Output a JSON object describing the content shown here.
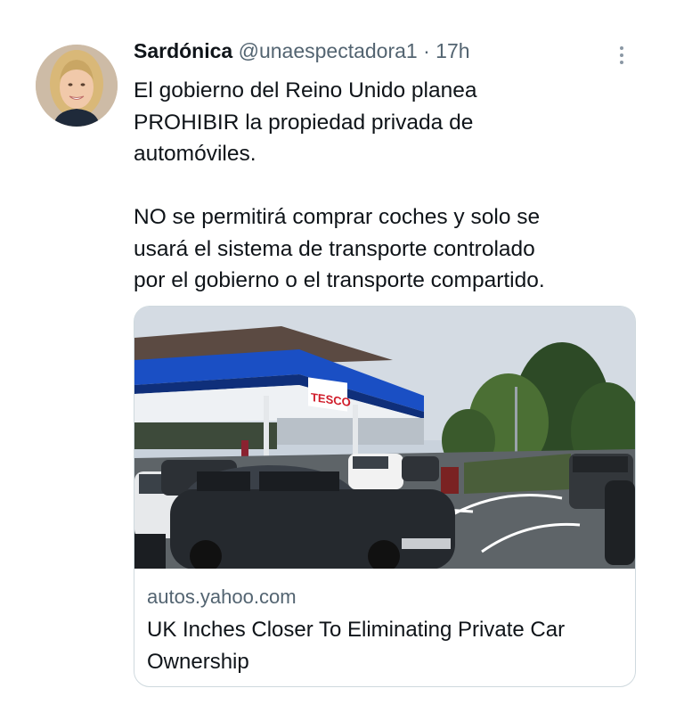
{
  "tweet": {
    "author_name": "Sardónica",
    "handle": "@unaespectadora1",
    "separator": "·",
    "time": "17h",
    "text_lines_1": [
      "El gobierno del Reino Unido planea",
      "PROHIBIR la propiedad privada de",
      "automóviles."
    ],
    "text_lines_2": [
      "NO se permitirá comprar coches  y solo se",
      "usará el sistema de transporte controlado",
      "por el gobierno o el transporte compartido."
    ]
  },
  "card": {
    "domain": "autos.yahoo.com",
    "title": "UK Inches Closer To Eliminating Private Car Ownership",
    "image_sign": "TESCO"
  },
  "icons": {
    "more": "more-vertical-icon",
    "avatar": "avatar"
  },
  "colors": {
    "text_primary": "#0f1419",
    "text_secondary": "#536471",
    "border": "#cfd9de",
    "canopy_blue": "#1a4fc4"
  }
}
